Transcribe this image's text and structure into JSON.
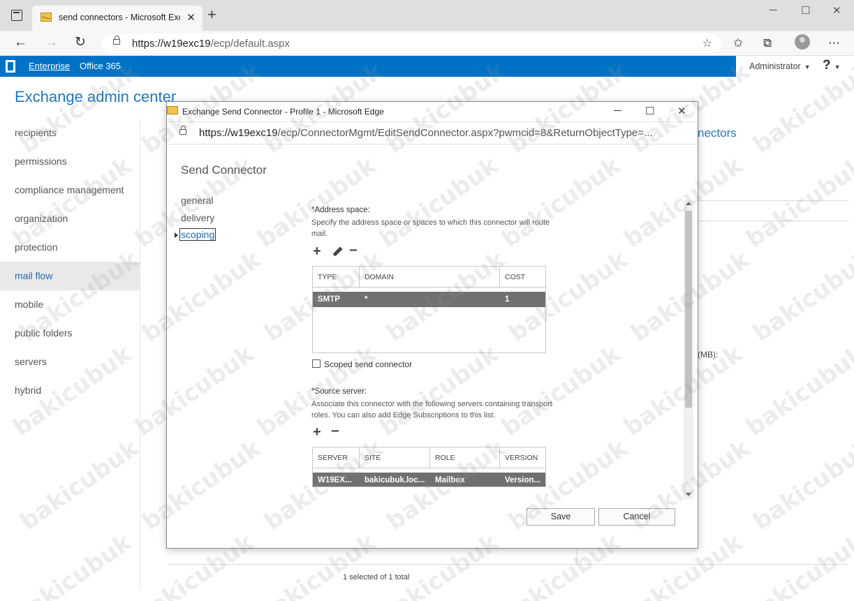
{
  "browser": {
    "tab_title": "send connectors - Microsoft Exch",
    "new_tab_symbol": "+",
    "url_host": "https://w19exc19",
    "url_path": "/ecp/default.aspx"
  },
  "suite_bar": {
    "enterprise": "Enterprise",
    "office365": "Office 365",
    "user": "Administrator",
    "help": "?"
  },
  "app_title": "Exchange admin center",
  "left_nav": [
    "recipients",
    "permissions",
    "compliance management",
    "organization",
    "protection",
    "mail flow",
    "mobile",
    "public folders",
    "servers",
    "hybrid"
  ],
  "left_nav_active": "mail flow",
  "background": {
    "right_link": "nectors",
    "mb_label": "(MB):",
    "status": "1 selected of 1 total"
  },
  "popup": {
    "window_title": "Exchange Send Connector - Profile 1 - Microsoft Edge",
    "url_host": "https://w19exc19",
    "url_path": "/ecp/ConnectorMgmt/EditSendConnector.aspx?pwmcid=8&ReturnObjectType=...",
    "heading": "Send Connector",
    "nav": [
      "general",
      "delivery",
      "scoping"
    ],
    "nav_active": "scoping",
    "address_space": {
      "label": "*Address space:",
      "description": "Specify the address space or spaces to which this connector will route mail.",
      "columns": [
        "TYPE",
        "DOMAIN",
        "COST"
      ],
      "rows": [
        {
          "type": "SMTP",
          "domain": "*",
          "cost": "1"
        }
      ]
    },
    "scoped_label": "Scoped send connector",
    "source_server": {
      "label": "*Source server:",
      "description": "Associate this connector with the following servers containing transport roles. You can also add Edge Subscriptions to this list.",
      "columns": [
        "SERVER",
        "SITE",
        "ROLE",
        "VERSION"
      ],
      "rows": [
        {
          "server": "W19EX...",
          "site": "bakicubuk.loc...",
          "role": "Mailbox",
          "version": "Version..."
        }
      ]
    },
    "save": "Save",
    "cancel": "Cancel"
  },
  "watermark": "bakicubuk"
}
